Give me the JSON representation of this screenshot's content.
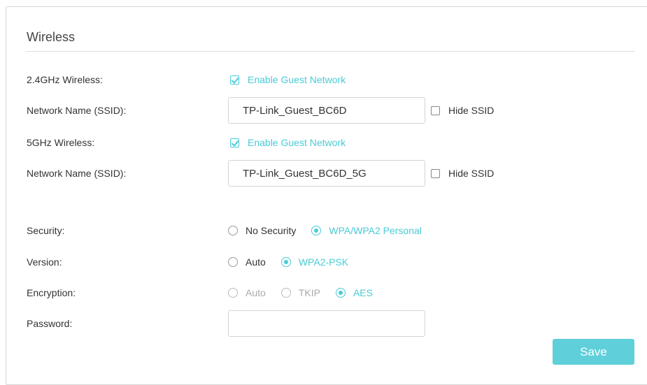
{
  "section": {
    "title": "Wireless"
  },
  "wireless24": {
    "label": "2.4GHz Wireless:",
    "enable_label": "Enable Guest Network",
    "ssid_label": "Network Name (SSID):",
    "ssid_value": "TP-Link_Guest_BC6D",
    "hide_ssid_label": "Hide SSID"
  },
  "wireless5": {
    "label": "5GHz Wireless:",
    "enable_label": "Enable Guest Network",
    "ssid_label": "Network Name (SSID):",
    "ssid_value": "TP-Link_Guest_BC6D_5G",
    "hide_ssid_label": "Hide SSID"
  },
  "security": {
    "label": "Security:",
    "options": [
      "No Security",
      "WPA/WPA2 Personal"
    ],
    "selected": "WPA/WPA2 Personal"
  },
  "version": {
    "label": "Version:",
    "options": [
      "Auto",
      "WPA2-PSK"
    ],
    "selected": "WPA2-PSK"
  },
  "encryption": {
    "label": "Encryption:",
    "options": [
      "Auto",
      "TKIP",
      "AES"
    ],
    "selected": "AES"
  },
  "password": {
    "label": "Password:",
    "value": ""
  },
  "actions": {
    "save_label": "Save"
  },
  "colors": {
    "accent": "#4acbd6",
    "button": "#5fcfd9",
    "text": "#333333"
  }
}
